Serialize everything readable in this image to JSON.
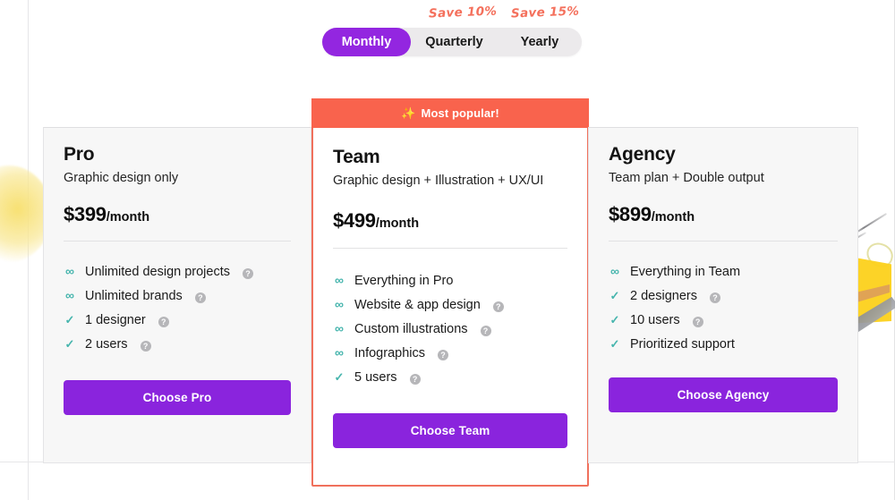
{
  "billing_toggle": {
    "options": [
      {
        "label": "Monthly",
        "active": true,
        "save_note": ""
      },
      {
        "label": "Quarterly",
        "active": false,
        "save_note": "Save 10%"
      },
      {
        "label": "Yearly",
        "active": false,
        "save_note": "Save 15%"
      }
    ],
    "save_note_quarterly": "Save 10%",
    "save_note_yearly": "Save 15%",
    "active_color": "#9326e0",
    "track_color": "#eceaec",
    "save_note_color": "#f4705c"
  },
  "theme": {
    "accent_purple": "#8a24dd",
    "banner_coral": "#f9634d",
    "feature_teal": "#46b5ad",
    "card_grey": "#f7f7f7",
    "help_grey": "#b6b6b9"
  },
  "plans": {
    "pro": {
      "name": "Pro",
      "description": "Graphic design only",
      "price": "$399",
      "period": "/month",
      "features": [
        {
          "icon": "infinity",
          "label": "Unlimited design projects",
          "help": true
        },
        {
          "icon": "infinity",
          "label": "Unlimited brands",
          "help": true
        },
        {
          "icon": "check",
          "label": "1 designer",
          "help": true
        },
        {
          "icon": "check",
          "label": "2 users",
          "help": true
        }
      ],
      "cta_label": "Choose Pro"
    },
    "team": {
      "badge": "Most popular!",
      "badge_icon": "sparkles-icon",
      "name": "Team",
      "description": "Graphic design + Illustration + UX/UI",
      "price": "$499",
      "period": "/month",
      "features": [
        {
          "icon": "infinity",
          "label": "Everything in Pro",
          "help": false
        },
        {
          "icon": "infinity",
          "label": "Website & app design",
          "help": true
        },
        {
          "icon": "infinity",
          "label": "Custom illustrations",
          "help": true
        },
        {
          "icon": "infinity",
          "label": "Infographics",
          "help": true
        },
        {
          "icon": "check",
          "label": "5 users",
          "help": true
        }
      ],
      "cta_label": "Choose Team"
    },
    "agency": {
      "name": "Agency",
      "description": "Team plan + Double output",
      "price": "$899",
      "period": "/month",
      "features": [
        {
          "icon": "infinity",
          "label": "Everything in Team",
          "help": false
        },
        {
          "icon": "check",
          "label": "2 designers",
          "help": true
        },
        {
          "icon": "check",
          "label": "10 users",
          "help": true
        },
        {
          "icon": "check",
          "label": "Prioritized support",
          "help": false
        }
      ],
      "cta_label": "Choose Agency"
    }
  },
  "glyphs": {
    "infinity": "∞",
    "check": "✓",
    "help": "?",
    "sparkles": "✨"
  }
}
